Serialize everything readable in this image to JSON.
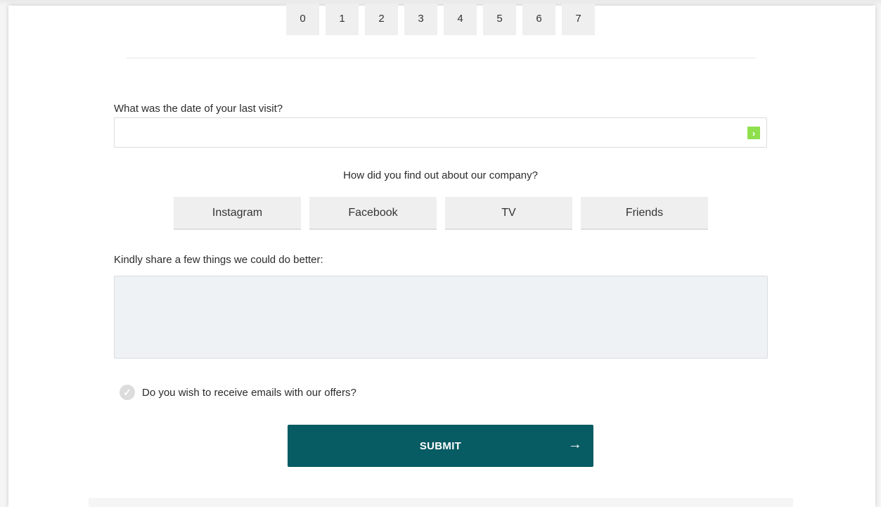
{
  "scale": {
    "options": [
      "0",
      "1",
      "2",
      "3",
      "4",
      "5",
      "6",
      "7"
    ]
  },
  "last_visit": {
    "label": "What was the date of your last visit?",
    "value": "",
    "placeholder": "",
    "button_icon": "chevron-right-icon",
    "button_glyph": "›",
    "button_color": "#8ee04d"
  },
  "source": {
    "question": "How did you find out about our company?",
    "options": [
      "Instagram",
      "Facebook",
      "TV",
      "Friends"
    ]
  },
  "feedback": {
    "label": "Kindly share a few things we could do better:",
    "value": "",
    "placeholder": ""
  },
  "optin": {
    "label": "Do you wish to receive emails with our offers?",
    "checked": false,
    "icon": "check-circle-icon",
    "glyph": "✓"
  },
  "submit": {
    "label": "SUBMIT",
    "arrow": "→",
    "color": "#075b63"
  }
}
